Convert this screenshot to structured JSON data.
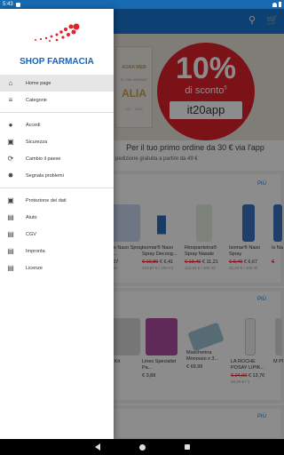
{
  "status": {
    "time": "5:43"
  },
  "app": {
    "promo": {
      "card_title": "AGNA WEB",
      "card_sub": "EL DELIVERING",
      "card_big": "ALIA",
      "card_years": "017 - 2018",
      "percent": "10%",
      "label": "di sconto",
      "sup": "5",
      "code": "it20app",
      "caption": "Per il tuo primo ordine da 30 € via l'app"
    },
    "shipping": "pedizione gratuita a partire da 49 €",
    "sections": [
      {
        "more": "PIÙ",
        "products": [
          {
            "name": "Naso Naso Spray Iper...",
            "old": "",
            "new": "€ 8,07",
            "unit": "100 ml"
          },
          {
            "name": "Isomar® Naso Spray Decong...",
            "old": "€ 10,80",
            "new": "€ 6,41",
            "unit": "213,67 € / 100 ml"
          },
          {
            "name": "Rinopanteina® Spray Nasale",
            "old": "€ 13,46",
            "new": "€ 11,21",
            "unit": "112,10 € / 100 ml"
          },
          {
            "name": "Isomar® Naso Spray",
            "old": "€ 9,40",
            "new": "€ 6,67",
            "unit": "22,23 € / 100 ml"
          },
          {
            "name": "Is Na",
            "old": "€",
            "new": "",
            "unit": ""
          }
        ]
      },
      {
        "more": "PIÙ",
        "products": [
          {
            "name": "rtso Kit",
            "old": "",
            "new": "",
            "unit": ""
          },
          {
            "name": "Lines Specialist Pa...",
            "old": "",
            "new": "€ 3,88",
            "unit": ""
          },
          {
            "name": "Mascherina Monouso x 3...",
            "old": "",
            "new": "€ 69,99",
            "unit": ""
          },
          {
            "name": "LA ROCHE POSAY LIPIK...",
            "old": "€ 24,99",
            "new": "€ 13,76",
            "unit": "34,40 € / 1"
          },
          {
            "name": "M Pl",
            "old": "",
            "new": "",
            "unit": ""
          }
        ]
      },
      {
        "more": "PIÙ",
        "products": []
      }
    ]
  },
  "drawer": {
    "logo_text": "SHOP FARMACIA",
    "items": [
      {
        "icon": "home-icon",
        "glyph": "⌂",
        "label": "Home page",
        "active": true
      },
      {
        "icon": "categories-icon",
        "glyph": "≡",
        "label": "Categorie",
        "active": false
      },
      {
        "icon": "account-icon",
        "glyph": "●",
        "label": "Accedi",
        "active": false
      },
      {
        "icon": "lock-icon",
        "glyph": "🔒",
        "label": "Sicurezza",
        "active": false
      },
      {
        "icon": "country-icon",
        "glyph": "⟳",
        "label": "Cambio il paese",
        "active": false
      },
      {
        "icon": "bug-icon",
        "glyph": "✸",
        "label": "Segnala problemi",
        "active": false
      },
      {
        "icon": "privacy-lock-icon",
        "glyph": "🔒",
        "label": "Protezione dei dati",
        "active": false
      },
      {
        "icon": "help-doc-icon",
        "glyph": "▤",
        "label": "Aiuto",
        "active": false
      },
      {
        "icon": "terms-doc-icon",
        "glyph": "▤",
        "label": "CGV",
        "active": false
      },
      {
        "icon": "imprint-doc-icon",
        "glyph": "▤",
        "label": "Impronta",
        "active": false
      },
      {
        "icon": "license-doc-icon",
        "glyph": "▤",
        "label": "Licenze",
        "active": false
      }
    ]
  },
  "colors": {
    "brand_blue": "#1565c0",
    "promo_red": "#e0222b",
    "appbar": "#1976d2"
  }
}
